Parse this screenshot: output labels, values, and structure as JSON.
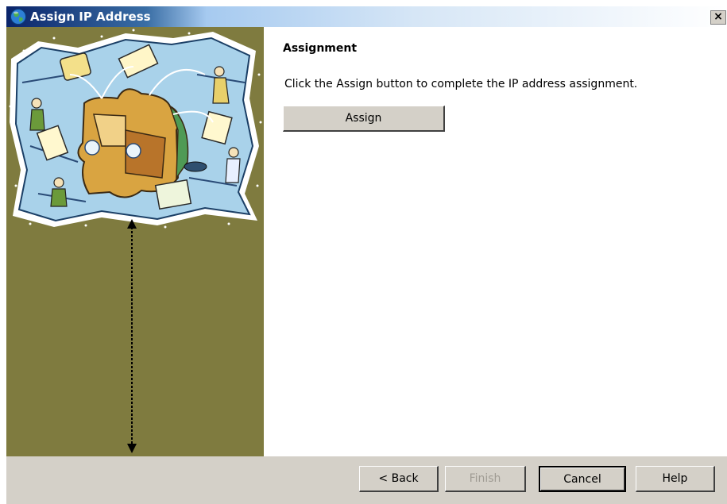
{
  "window": {
    "title": "Assign IP Address",
    "close_label": "×"
  },
  "content": {
    "heading": "Assignment",
    "instruction": "Click the Assign button to complete the IP address assignment.",
    "assign_label": "Assign"
  },
  "footer": {
    "back_label": "< Back",
    "finish_label": "Finish",
    "cancel_label": "Cancel",
    "help_label": "Help"
  },
  "icons": {
    "app": "globe-icon",
    "close": "close-icon",
    "illustration": "wizard-illustration",
    "arrow": "double-arrow-icon"
  },
  "colors": {
    "left_panel": "#7f7b3f",
    "title_active": "#0a246a",
    "button_face": "#d4d0c8"
  }
}
